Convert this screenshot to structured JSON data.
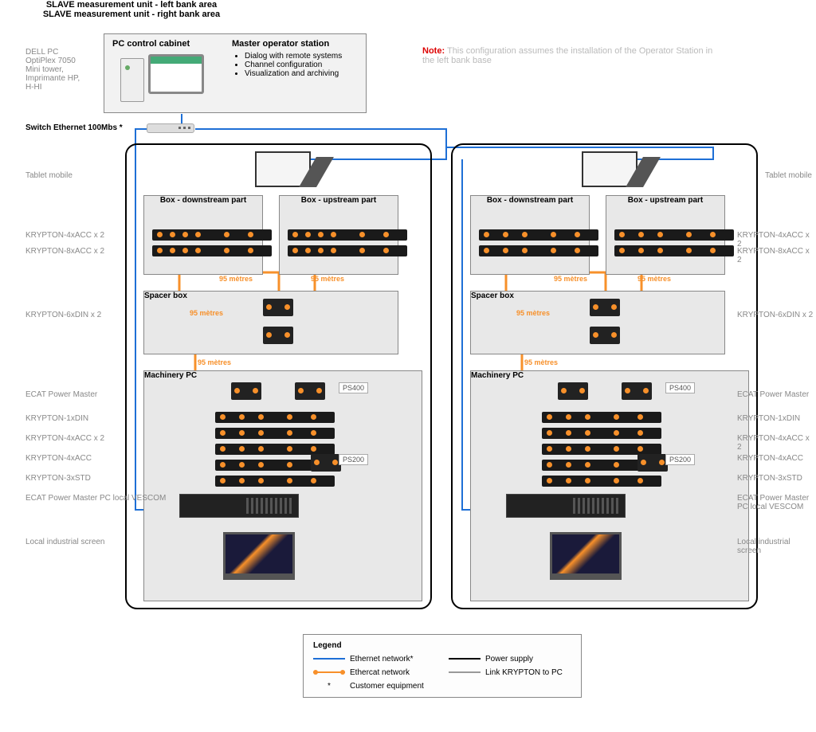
{
  "pc_cabinet": {
    "title": "PC control cabinet",
    "master_title": "Master operator station",
    "bullets": [
      "Dialog with remote systems",
      "Channel configuration",
      "Visualization and archiving"
    ],
    "spec": "DELL PC OptiPlex 7050 Mini tower, Imprimante HP, H-HI"
  },
  "switch_label": "Switch Ethernet 100Mbs *",
  "note": {
    "prefix": "Note:",
    "text": "This configuration assumes the installation of the Operator Station in the left bank base"
  },
  "left": {
    "unit_title": "SLAVE measurement unit - left bank area",
    "box_down": "Box - downstream part",
    "box_up": "Box - upstream part",
    "spacer": "Spacer box",
    "machinery": "Machinery PC"
  },
  "right": {
    "unit_title": "SLAVE measurement unit - right bank area",
    "box_down": "Box - downstream part",
    "box_up": "Box - upstream part",
    "spacer": "Spacer box",
    "machinery": "Machinery PC"
  },
  "distances": {
    "d95": "95 mètres"
  },
  "power": {
    "ps400": "PS400",
    "ps200": "PS200"
  },
  "side_labels": {
    "tablet": "Tablet mobile",
    "krypton_4acc2": "KRYPTON-4xACC x 2",
    "krypton_8acc2": "KRYPTON-8xACC x 2",
    "krypton_6din2": "KRYPTON-6xDIN x 2",
    "ecat_master": "ECAT Power Master",
    "krypton_1din": "KRYPTON-1xDIN",
    "krypton_4acc2b": "KRYPTON-4xACC x 2",
    "krypton_4acc": "KRYPTON-4xACC",
    "krypton_3std": "KRYPTON-3xSTD",
    "ecat_pc": "ECAT Power Master PC local VESCOM",
    "local_panel": "Local industrial screen"
  },
  "legend": {
    "title": "Legend",
    "eth": "Ethernet network*",
    "ecat": "Ethercat network",
    "cust": "Customer equipment",
    "power": "Power supply",
    "link": "Link KRYPTON to PC",
    "asterisk": "*"
  }
}
